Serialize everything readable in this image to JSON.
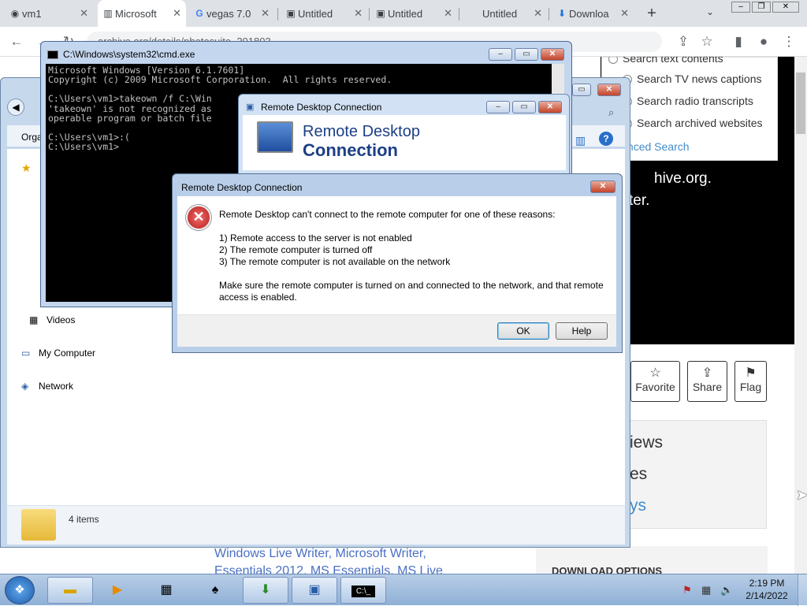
{
  "browser": {
    "tabs": [
      {
        "label": "vm1",
        "icon": "github-icon",
        "active": false
      },
      {
        "label": "Microsoft",
        "icon": "archive-icon",
        "active": true
      },
      {
        "label": "vegas 7.0",
        "icon": "google-icon",
        "active": false
      },
      {
        "label": "Untitled",
        "icon": "folder-icon",
        "active": false
      },
      {
        "label": "Untitled",
        "icon": "folder-icon",
        "active": false
      },
      {
        "label": "Untitled",
        "icon": "blank-icon",
        "active": false
      },
      {
        "label": "Downloa",
        "icon": "download-icon",
        "active": false
      }
    ],
    "new_tab": "+",
    "url": "archive.org/details/photosuite_201803"
  },
  "archive": {
    "search_options": [
      "Search text contents",
      "Search TV news captions",
      "Search radio transcripts",
      "Search archived websites"
    ],
    "advanced_search": "Advanced Search",
    "dark_line1": "hive.org.",
    "dark_line2": "ter.",
    "actions": [
      "Favorite",
      "Share",
      "Flag"
    ],
    "stats": [
      "iews",
      "es",
      "ys"
    ],
    "links_line1": "Windows Live Writer, Microsoft Writer,",
    "links_line2": "Essentials 2012, MS Essentials, MS Live",
    "download_options": "DOWNLOAD OPTIONS"
  },
  "explorer": {
    "organize": "Orga",
    "nav": [
      "Videos",
      "My Computer",
      "Network"
    ],
    "status": "4 items"
  },
  "cmd": {
    "title": "C:\\Windows\\system32\\cmd.exe",
    "lines": [
      "Microsoft Windows [Version 6.1.7601]",
      "Copyright (c) 2009 Microsoft Corporation.  All rights reserved.",
      "",
      "C:\\Users\\vm1>takeown /f C:\\Win",
      "'takeown' is not recognized as",
      "operable program or batch file",
      "",
      "C:\\Users\\vm1>:(",
      "C:\\Users\\vm1>"
    ]
  },
  "rdc_window": {
    "title": "Remote Desktop Connection",
    "heading1": "Remote Desktop",
    "heading2": "Connection"
  },
  "dialog": {
    "title": "Remote Desktop Connection",
    "intro": "Remote Desktop can't connect to the remote computer for one of these reasons:",
    "reasons": [
      "1) Remote access to the server is not enabled",
      "2) The remote computer is turned off",
      "3) The remote computer is not available on the network"
    ],
    "advice": "Make sure the remote computer is turned on and connected to the network, and that remote access is enabled.",
    "ok_label": "OK",
    "help_label": "Help"
  },
  "taskbar": {
    "time": "2:19 PM",
    "date": "2/14/2022"
  }
}
